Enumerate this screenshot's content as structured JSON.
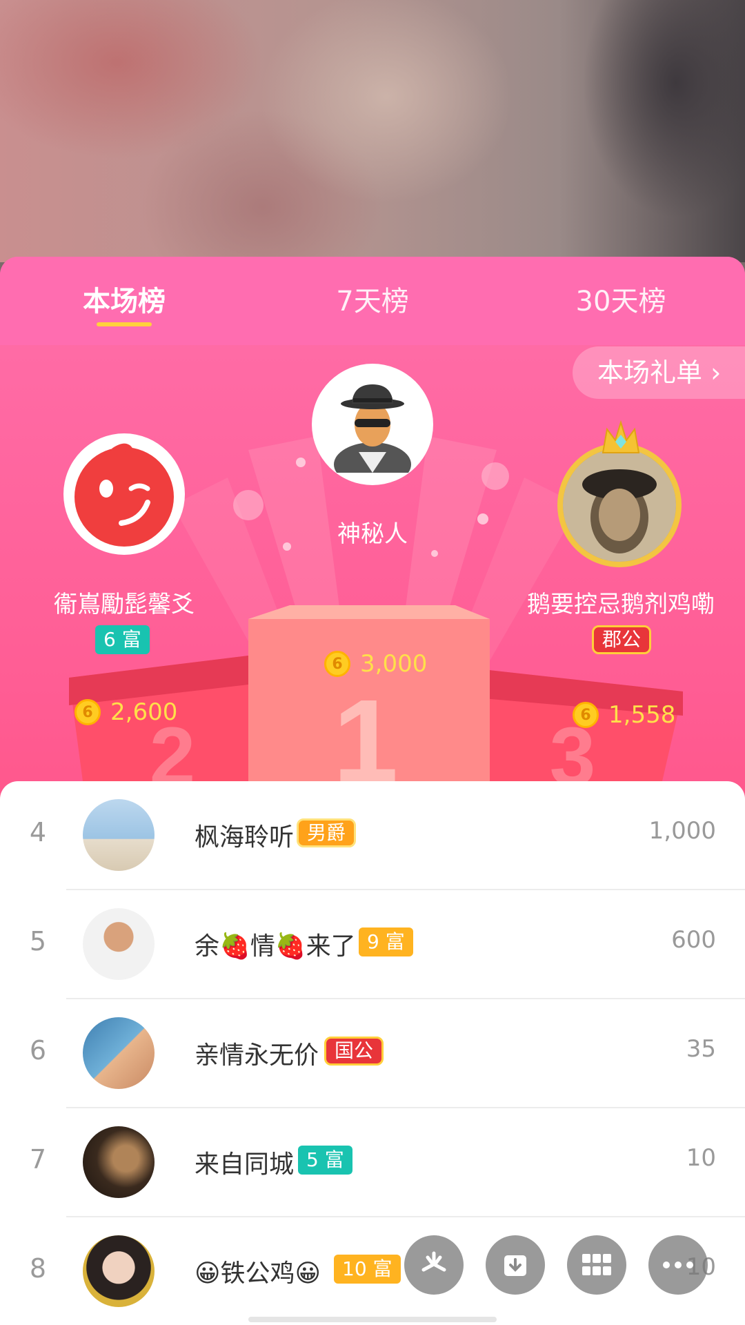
{
  "tabs": [
    {
      "label": "本场榜",
      "active": true
    },
    {
      "label": "7天榜",
      "active": false
    },
    {
      "label": "30天榜",
      "active": false
    }
  ],
  "gift_list_button": "本场礼单 ›",
  "top3": {
    "first": {
      "rank": 1,
      "name": "神秘人",
      "score": "3,000"
    },
    "second": {
      "rank": 2,
      "name": "衞嶌勵髭馨爻",
      "badge": "6 富",
      "score": "2,600"
    },
    "third": {
      "rank": 3,
      "name": "鹅要控忌鹅剂鸡嘞",
      "badge": "郡公",
      "score": "1,558"
    }
  },
  "coin_glyph": "6",
  "podium_numbers": {
    "first": "1",
    "second": "2",
    "third": "3"
  },
  "rows": [
    {
      "rank": "4",
      "name": "枫海聆听",
      "badge": "男爵",
      "badge_style": "gold",
      "score": "1,000"
    },
    {
      "rank": "5",
      "name": "余🍓情🍓来了",
      "badge": "9 富",
      "badge_style": "orange",
      "score": "600"
    },
    {
      "rank": "6",
      "name": "亲情永无价",
      "badge": "国公",
      "badge_style": "red",
      "score": "35"
    },
    {
      "rank": "7",
      "name": "来自同城",
      "badge": "5 富",
      "badge_style": "teal",
      "score": "10"
    },
    {
      "rank": "8",
      "name": "😀铁公鸡😀",
      "badge": "10 富",
      "badge_style": "orange",
      "score": "10"
    }
  ],
  "fab_icons": [
    "sparkle-icon",
    "download-icon",
    "grid-icon",
    "more-icon"
  ],
  "colors": {
    "panel_pink": "#ff5d94",
    "tab_indicator": "#ffd23c",
    "coin_gold": "#ffcc22",
    "score_gold": "#ffe04a"
  }
}
